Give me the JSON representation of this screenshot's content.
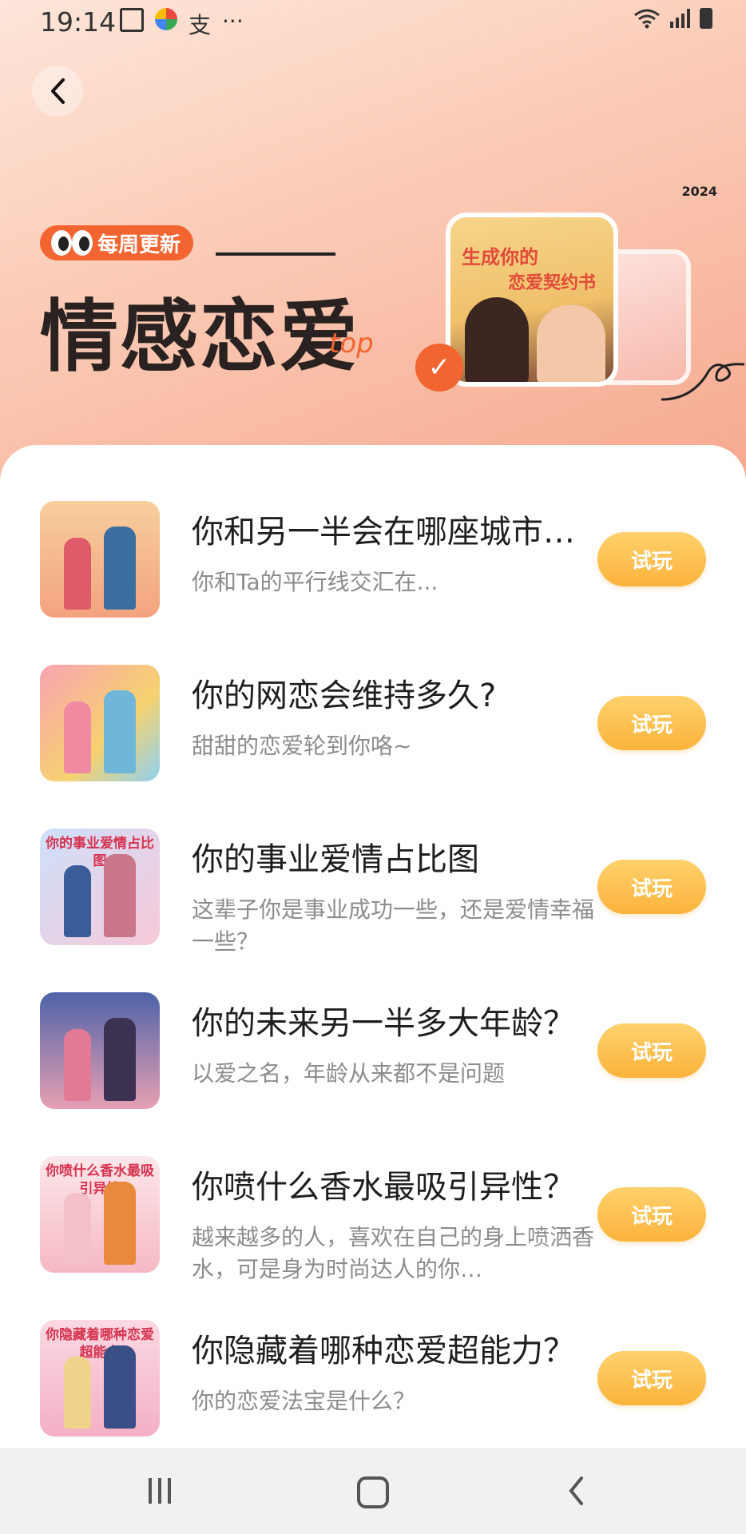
{
  "status_bar": {
    "time": "19:14",
    "left_icons": [
      "gallery-icon",
      "app-icon",
      "alipay-icon",
      "more-icon"
    ],
    "alipay_glyph": "支",
    "more_glyph": "···",
    "right_icons": [
      "wifi-icon",
      "signal-icon",
      "battery-icon"
    ]
  },
  "header": {
    "badge": "每周更新",
    "title": "情感恋爱",
    "title_script": "top",
    "year": "2024",
    "card_text_1": "生成你的",
    "card_text_2": "恋爱契约书",
    "accent": "#f26430"
  },
  "items": [
    {
      "title": "你和另一半会在哪座城市…",
      "subtitle": "你和Ta的平行线交汇在...",
      "button": "试玩"
    },
    {
      "title": "你的网恋会维持多久?",
      "subtitle": "甜甜的恋爱轮到你咯~",
      "button": "试玩"
    },
    {
      "title": "你的事业爱情占比图",
      "subtitle": "这辈子你是事业成功一些，还是爱情幸福一些？",
      "button": "试玩",
      "thumb_caption": "你的事业爱情占比图"
    },
    {
      "title": "你的未来另一半多大年龄？",
      "subtitle": "以爱之名，年龄从来都不是问题",
      "button": "试玩"
    },
    {
      "title": "你喷什么香水最吸引异性？",
      "subtitle": "越来越多的人，喜欢在自己的身上喷洒香水，可是身为时尚达人的你…",
      "button": "试玩",
      "thumb_caption": "你喷什么香水最吸引异性"
    },
    {
      "title": "你隐藏着哪种恋爱超能力？",
      "subtitle": "你的恋爱法宝是什么？",
      "button": "试玩",
      "thumb_caption": "你隐藏着哪种恋爱超能力"
    }
  ],
  "nav": {
    "buttons": [
      "recents-icon",
      "home-icon",
      "back-icon"
    ]
  }
}
